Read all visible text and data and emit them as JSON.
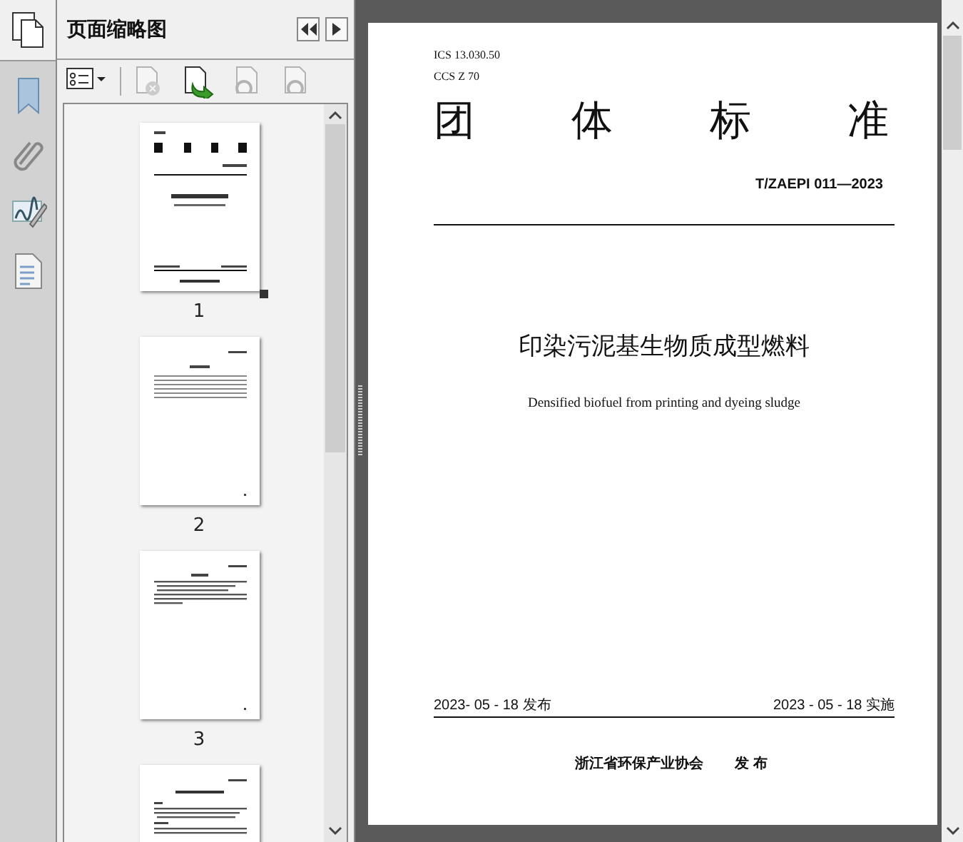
{
  "panel": {
    "title": "页面缩略图"
  },
  "toolbar": [
    {
      "kind": "options",
      "disabled": false
    },
    {
      "kind": "delete",
      "disabled": true
    },
    {
      "kind": "insert",
      "disabled": false
    },
    {
      "kind": "undo",
      "disabled": true
    },
    {
      "kind": "redo",
      "disabled": true
    }
  ],
  "thumbnails": [
    {
      "kind": "cover",
      "label": "1"
    },
    {
      "kind": "contents",
      "label": "2"
    },
    {
      "kind": "foreword",
      "label": "3"
    },
    {
      "kind": "body"
    }
  ],
  "document": {
    "ics": "ICS  13.030.50",
    "ccs": "CCS Z 70",
    "heading": [
      "团",
      "体",
      "标",
      "准"
    ],
    "code": "T/ZAEPI 011—2023",
    "title_zh": "印染污泥基生物质成型燃料",
    "title_en": "Densified biofuel from printing and dyeing sludge",
    "publish_date": "2023- 05 - 18 发布",
    "effective_date": "2023 - 05 - 18 实施",
    "publisher": "浙江省环保产业协会",
    "publisher_action": "发 布"
  }
}
